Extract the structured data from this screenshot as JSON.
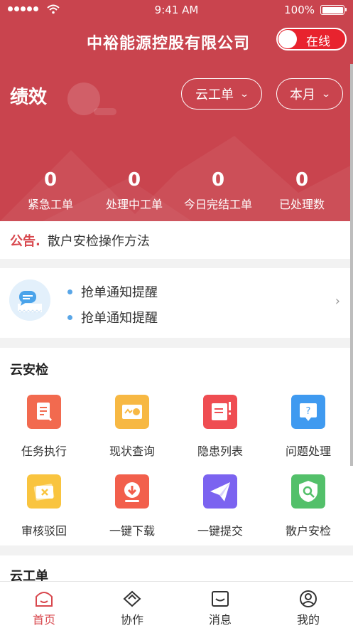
{
  "status_bar": {
    "time": "9:41 AM",
    "battery": "100%"
  },
  "header": {
    "company": "中裕能源控股有限公司",
    "online_toggle": {
      "label": "在线",
      "on": true
    },
    "title": "绩效",
    "filters": [
      {
        "label": "云工单"
      },
      {
        "label": "本月"
      }
    ]
  },
  "stats": [
    {
      "value": "0",
      "label": "紧急工单"
    },
    {
      "value": "0",
      "label": "处理中工单"
    },
    {
      "value": "0",
      "label": "今日完结工单"
    },
    {
      "value": "0",
      "label": "已处理数"
    }
  ],
  "notice": {
    "tag": "公告.",
    "text": "散户安检操作方法"
  },
  "reminders": [
    {
      "text": "抢单通知提醒"
    },
    {
      "text": "抢单通知提醒"
    }
  ],
  "yun_anjian": {
    "title": "云安检",
    "items": [
      {
        "label": "任务执行",
        "icon": "task-execute-icon",
        "color": "#f26a4f"
      },
      {
        "label": "现状查询",
        "icon": "status-query-icon",
        "color": "#f7b843"
      },
      {
        "label": "隐患列表",
        "icon": "hazard-list-icon",
        "color": "#ef4d52"
      },
      {
        "label": "问题处理",
        "icon": "problem-handle-icon",
        "color": "#3f9af0"
      },
      {
        "label": "审核驳回",
        "icon": "review-reject-icon",
        "color": "#f9c43f"
      },
      {
        "label": "一键下载",
        "icon": "download-icon",
        "color": "#f25f4c"
      },
      {
        "label": "一键提交",
        "icon": "submit-icon",
        "color": "#7b63f0"
      },
      {
        "label": "散户安检",
        "icon": "household-check-icon",
        "color": "#53c06a"
      }
    ]
  },
  "yun_gongdan": {
    "title": "云工单"
  },
  "tabbar": [
    {
      "label": "首页",
      "icon": "home-icon",
      "active": true
    },
    {
      "label": "协作",
      "icon": "collaborate-icon",
      "active": false
    },
    {
      "label": "消息",
      "icon": "message-icon",
      "active": false
    },
    {
      "label": "我的",
      "icon": "profile-icon",
      "active": false
    }
  ]
}
